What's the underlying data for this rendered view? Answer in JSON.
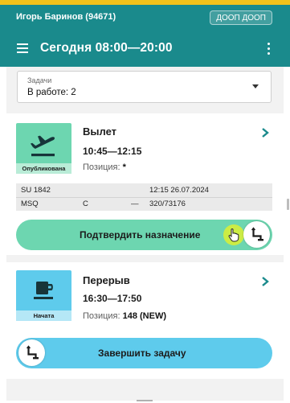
{
  "header": {
    "user": "Игорь Баринов (94671)",
    "org_chip": "ДООП ДООП",
    "title": "Сегодня 08:00—20:00",
    "bg_color": "#1a8a8c",
    "accent_strip": "#f2c21b"
  },
  "filter": {
    "label": "Задачи",
    "value": "В работе: 2"
  },
  "tasks": [
    {
      "title": "Вылет",
      "time": "10:45—12:15",
      "position_label": "Позиция:",
      "position_value": "*",
      "status": "Опубликована",
      "icon": "airplane-takeoff-icon",
      "color": "#6dd6b0",
      "flight": {
        "rows": [
          [
            "SU 1842",
            "",
            "",
            "12:15 26.07.2024"
          ],
          [
            "MSQ",
            "C",
            "—",
            "320/73176"
          ]
        ]
      },
      "action": "Подтвердить назначение"
    },
    {
      "title": "Перерыв",
      "time": "16:30—17:50",
      "position_label": "Позиция:",
      "position_value": "148 (NEW)",
      "status": "Начата",
      "icon": "coffee-cup-icon",
      "color": "#5ecbec",
      "action": "Завершить задачу"
    }
  ]
}
